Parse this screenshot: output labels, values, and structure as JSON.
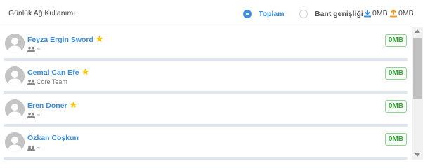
{
  "header": {
    "title": "Günlük Ağ Kullanımı",
    "mode_options": [
      {
        "label": "Toplam",
        "selected": true
      },
      {
        "label": "Bant genişliği",
        "selected": false
      }
    ],
    "download_total": "0MB",
    "upload_total": "0MB"
  },
  "colors": {
    "accent": "#3a8fe0",
    "badge_green": "#3aa33a",
    "star": "#f5c518",
    "bar": "#dfe6ee"
  },
  "users": [
    {
      "name": "Feyza Ergin Sword",
      "starred": true,
      "group": "~",
      "usage": "0MB"
    },
    {
      "name": "Cemal Can Efe",
      "starred": true,
      "group": "Core Team",
      "usage": "0MB"
    },
    {
      "name": "Eren Doner",
      "starred": true,
      "group": "~",
      "usage": "0MB"
    },
    {
      "name": "Özkan Coşkun",
      "starred": false,
      "group": "~",
      "usage": "0MB"
    }
  ]
}
